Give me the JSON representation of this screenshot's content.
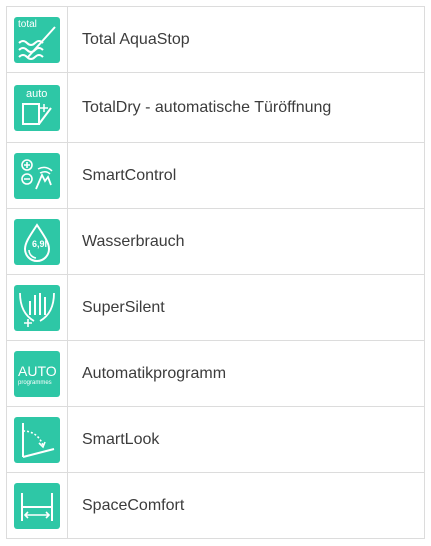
{
  "accent_color": "#2ec7a6",
  "features": [
    {
      "label": "Total AquaStop",
      "icon": "total-aquastop-icon",
      "icon_text": "total"
    },
    {
      "label": "TotalDry - automatische Türöffnung",
      "icon": "auto-door-open-icon",
      "icon_text": "auto"
    },
    {
      "label": "SmartControl",
      "icon": "smart-control-icon"
    },
    {
      "label": "Wasserbrauch",
      "icon": "water-drop-icon",
      "icon_text": "6,9l"
    },
    {
      "label": "SuperSilent",
      "icon": "super-silent-icon"
    },
    {
      "label": "Automatikprogramm",
      "icon": "auto-programmes-icon",
      "icon_text": "AUTO",
      "icon_subtext": "programmes"
    },
    {
      "label": "SmartLook",
      "icon": "smart-look-icon"
    },
    {
      "label": "SpaceComfort",
      "icon": "space-comfort-icon"
    }
  ]
}
